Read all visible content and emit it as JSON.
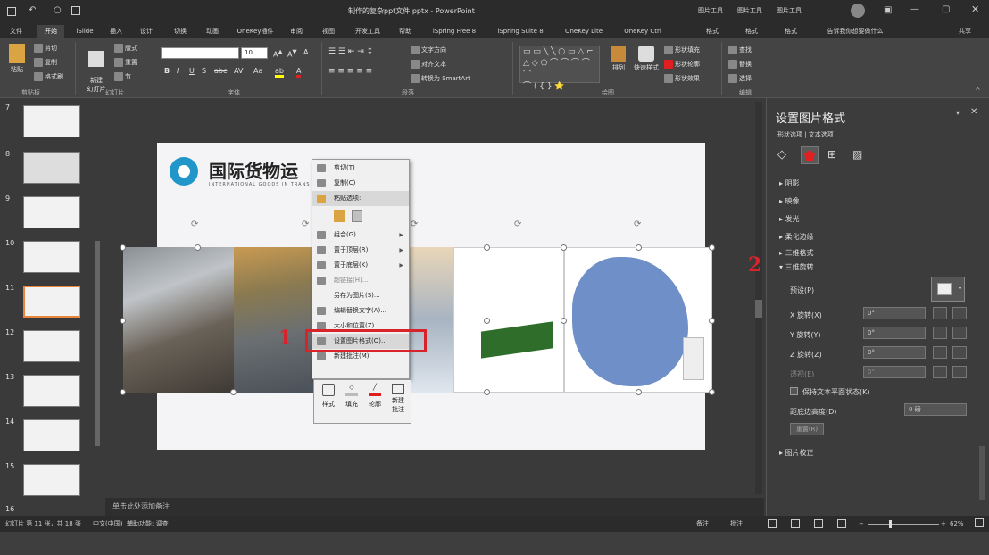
{
  "titlebar": {
    "doc_title": "制作的复杂ppt文件.pptx - PowerPoint",
    "ctx1": "图片工具",
    "ctx2": "图片工具",
    "ctx3": "图片工具",
    "user": "用户"
  },
  "tabs": [
    "文件",
    "开始",
    "iSlide",
    "插入",
    "设计",
    "切换",
    "动画",
    "OneKey插件",
    "审阅",
    "视图",
    "开发工具",
    "帮助",
    "iSpring Free 8",
    "iSpring Suite 8",
    "OneKey Lite",
    "OneKey Ctrl",
    "格式",
    "格式",
    "格式",
    "告诉我你想要做什么",
    "共享"
  ],
  "ribbon": {
    "paste": "粘贴",
    "cut": "剪切",
    "copy": "复制",
    "format_painter": "格式刷",
    "new_slide": "新建\n幻灯片",
    "layout": "版式",
    "reset": "重置",
    "section": "节",
    "font_size": "10",
    "text_direction": "文字方向",
    "align_text": "对齐文本",
    "smartart": "转换为 SmartArt",
    "arrange": "排列",
    "quick_styles": "快速样式",
    "shape_fill": "形状填充",
    "shape_outline": "形状轮廓",
    "shape_effects": "形状效果",
    "find": "查找",
    "replace": "替换",
    "select": "选择",
    "grp_clipboard": "剪贴板",
    "grp_slides": "幻灯片",
    "grp_font": "字体",
    "grp_paragraph": "段落",
    "grp_drawing": "绘图",
    "grp_editing": "编辑"
  },
  "thumbnails": [
    "7",
    "8",
    "9",
    "10",
    "11",
    "12",
    "13",
    "14",
    "15",
    "16"
  ],
  "slide": {
    "title": "国际货物运",
    "subtitle": "INTERNATIONAL GOODS IN TRANS"
  },
  "context_menu": {
    "items": [
      "剪切(T)",
      "复制(C)",
      "粘贴选项:",
      "",
      "组合(G)",
      "置于顶层(R)",
      "置于底层(K)",
      "超链接(H)...",
      "另存为图片(S)...",
      "编辑替换文字(A)...",
      "大小和位置(Z)...",
      "设置图片格式(O)...",
      "新建批注(M)"
    ],
    "mini": [
      "样式",
      "填充",
      "轮廓",
      "新建\n批注"
    ]
  },
  "annotations": {
    "one": "1",
    "two": "2"
  },
  "format_pane": {
    "title": "设置图片格式",
    "subtabs": "形状选项 | 文本选项",
    "sections": [
      "阴影",
      "映像",
      "发光",
      "柔化边缘",
      "三维格式",
      "三维旋转",
      "图片校正"
    ],
    "preset": "预设(P)",
    "x_rotation": "X 旋转(X)",
    "y_rotation": "Y 旋转(Y)",
    "z_rotation": "Z 旋转(Z)",
    "perspective": "透视(E)",
    "keep_text_flat": "保持文本平面状态(K)",
    "distance": "距底边高度(D)",
    "distance_value": "0 磅",
    "reset": "重置(R)",
    "rot_value": "0°"
  },
  "notes": "单击此处添加备注",
  "status": {
    "slide_info": "幻灯片 第 11 张，共 18 张",
    "language": "中文(中国)",
    "accessibility": "辅助功能: 调查",
    "notes_btn": "备注",
    "comments_btn": "批注",
    "zoom": "62%"
  },
  "colors": {
    "accent": "#d8232a",
    "selection": "#e8843e"
  }
}
